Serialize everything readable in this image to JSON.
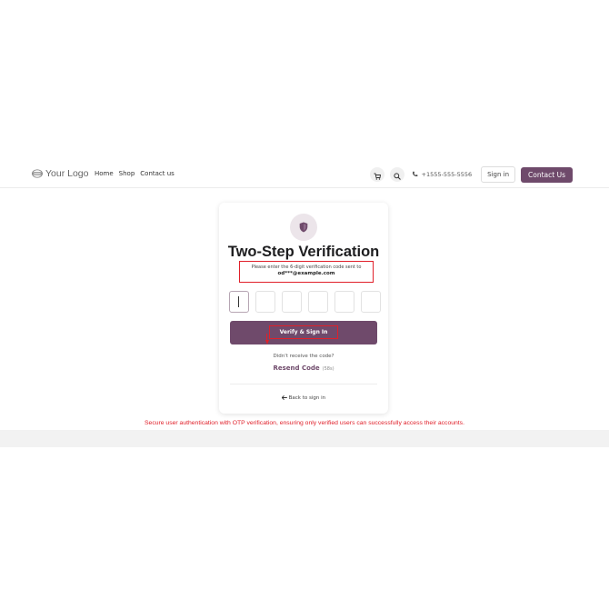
{
  "header": {
    "logo_text": "Your Logo",
    "nav": [
      "Home",
      "Shop",
      "Contact us"
    ],
    "phone": "+1555-555-5556",
    "sign_in": "Sign in",
    "contact": "Contact Us"
  },
  "card": {
    "title": "Two-Step Verification",
    "description": "Please enter the 6-digit verification code sent to",
    "email": "od***@example.com",
    "otp_count": 6,
    "verify_label": "Verify & Sign In",
    "no_code": "Didn't receive the code?",
    "resend": "Resend Code",
    "timer": "(58s)",
    "back": "Back to sign in"
  },
  "caption": "Secure user authentication with OTP verification, ensuring only verified users can successfully access their accounts.",
  "colors": {
    "brand": "#6f4a6b",
    "highlight": "#e0202a"
  },
  "icons": [
    "logo-icon",
    "cart-icon",
    "search-icon",
    "phone-icon",
    "shield-icon",
    "arrow-left-icon"
  ]
}
